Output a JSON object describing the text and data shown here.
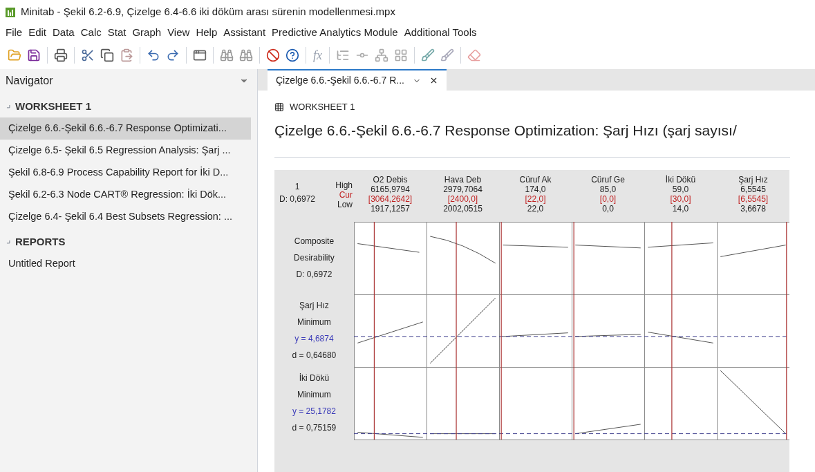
{
  "window": {
    "title": "Minitab - Şekil 6.2-6.9, Çizelge 6.4-6.6 iki döküm arası sürenin modellenmesi.mpx"
  },
  "menu": [
    "File",
    "Edit",
    "Data",
    "Calc",
    "Stat",
    "Graph",
    "View",
    "Help",
    "Assistant",
    "Predictive Analytics Module",
    "Additional Tools"
  ],
  "toolbar": {
    "formula_button": "fx"
  },
  "navigator": {
    "title": "Navigator",
    "sections": [
      {
        "label": "WORKSHEET 1",
        "expanded": true,
        "items": [
          {
            "label": "Çizelge 6.6.-Şekil 6.6.-6.7 Response Optimizati...",
            "selected": true
          },
          {
            "label": "Çizelge 6.5- Şekil 6.5 Regression Analysis: Şarj ...",
            "selected": false
          },
          {
            "label": "Şekil 6.8-6.9 Process Capability Report for İki D...",
            "selected": false
          },
          {
            "label": "Şekil 6.2-6.3 Node CART® Regression: İki Dök...",
            "selected": false
          },
          {
            "label": "Çizelge 6.4- Şekil 6.4 Best Subsets Regression: ...",
            "selected": false
          }
        ]
      },
      {
        "label": "REPORTS",
        "expanded": true,
        "items": [
          {
            "label": "Untitled Report",
            "selected": false
          }
        ]
      }
    ]
  },
  "tabs": [
    {
      "label": "Çizelge 6.6.-Şekil 6.6.-6.7 R...",
      "selected": true
    }
  ],
  "output": {
    "worksheet": "WORKSHEET 1",
    "heading": "Çizelge 6.6.-Şekil 6.6.-6.7 Response Optimization: Şarj Hızı (şarj sayısı/",
    "plot": {
      "solution": "1",
      "composite": "D: 0,6972",
      "row_labels": [
        "High",
        "Cur",
        "Low"
      ],
      "factors": [
        {
          "name": "O2 Debis",
          "high": "6165,9794",
          "cur": "[3064,2642]",
          "low": "1917,1257"
        },
        {
          "name": "Hava Deb",
          "high": "2979,7064",
          "cur": "[2400,0]",
          "low": "2002,0515"
        },
        {
          "name": "Cüruf Ak",
          "high": "174,0",
          "cur": "[22,0]",
          "low": "22,0"
        },
        {
          "name": "Cüruf Ge",
          "high": "85,0",
          "cur": "[0,0]",
          "low": "0,0"
        },
        {
          "name": "İki Dökü",
          "high": "59,0",
          "cur": "[30,0]",
          "low": "14,0"
        },
        {
          "name": "Şarj Hız",
          "high": "6,5545",
          "cur": "[6,5545]",
          "low": "3,6678"
        }
      ],
      "responses": [
        {
          "lines": [
            {
              "text": "Composite",
              "kind": "plain"
            },
            {
              "text": "Desirability",
              "kind": "plain"
            },
            {
              "text": "D: 0,6972",
              "kind": "plain"
            }
          ]
        },
        {
          "lines": [
            {
              "text": "Şarj Hız",
              "kind": "plain"
            },
            {
              "text": "Minimum",
              "kind": "plain"
            },
            {
              "text": "y = 4,6874",
              "kind": "predicted"
            },
            {
              "text": "d = 0,64680",
              "kind": "plain"
            }
          ]
        },
        {
          "lines": [
            {
              "text": "İki Dökü",
              "kind": "plain"
            },
            {
              "text": "Minimum",
              "kind": "plain"
            },
            {
              "text": "y = 25,1782",
              "kind": "predicted"
            },
            {
              "text": "d = 0,75159",
              "kind": "plain"
            }
          ]
        }
      ]
    }
  }
}
